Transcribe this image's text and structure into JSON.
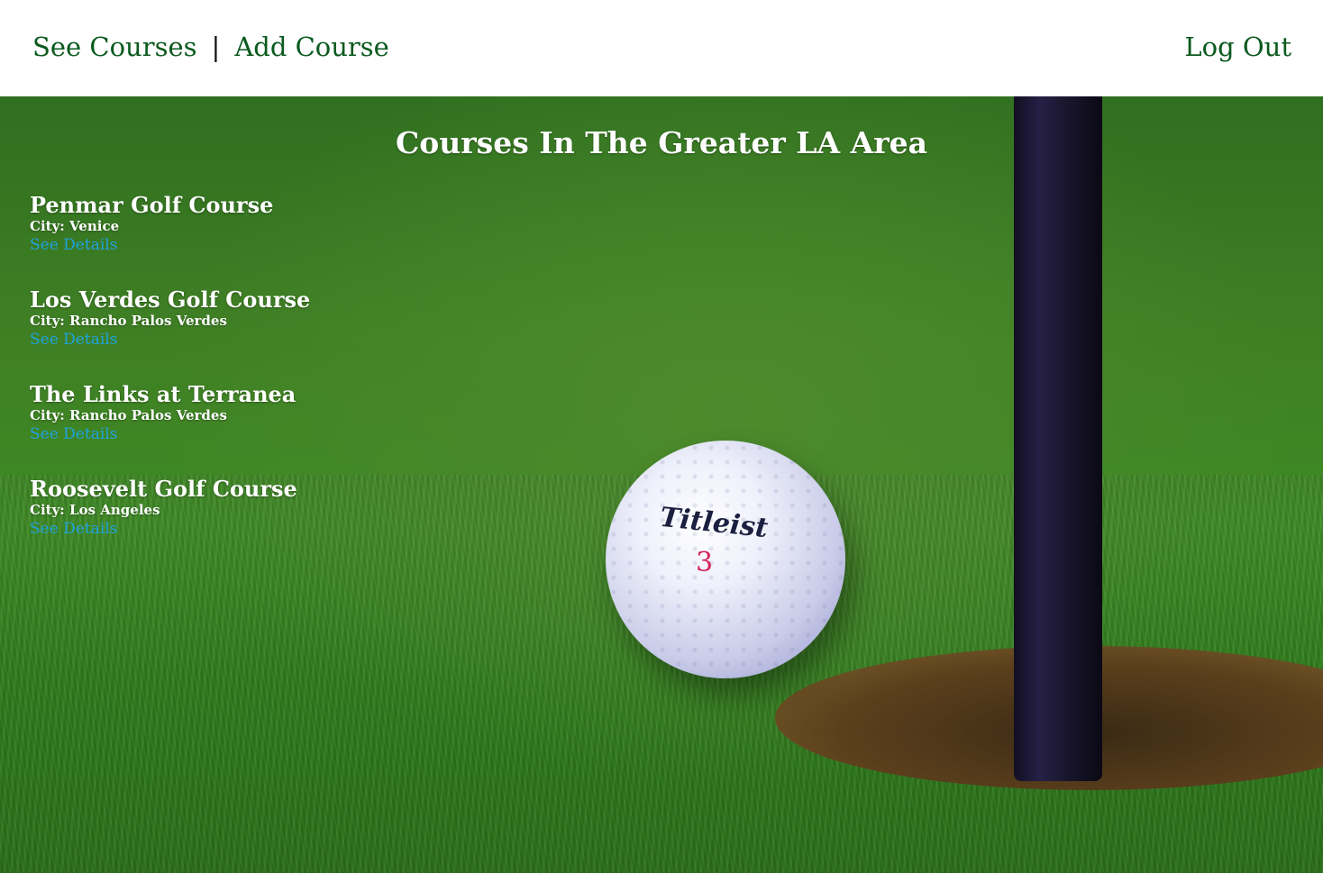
{
  "nav": {
    "see_courses": "See Courses",
    "separator": "|",
    "add_course": "Add Course",
    "log_out": "Log Out"
  },
  "page": {
    "title": "Courses In The Greater LA Area"
  },
  "courses": [
    {
      "name": "Penmar Golf Course",
      "city": "City: Venice",
      "link": "See Details"
    },
    {
      "name": "Los Verdes Golf Course",
      "city": "City: Rancho Palos Verdes",
      "link": "See Details"
    },
    {
      "name": "The Links at Terranea",
      "city": "City: Rancho Palos Verdes",
      "link": "See Details"
    },
    {
      "name": "Roosevelt Golf Course",
      "city": "City: Los Angeles",
      "link": "See Details"
    }
  ],
  "background_photo": {
    "ball_brand": "Titleist",
    "ball_number": "3"
  },
  "colors": {
    "nav_link": "#0b5a1e",
    "details_link": "#1fa3de",
    "heading_text": "#ffffff"
  }
}
